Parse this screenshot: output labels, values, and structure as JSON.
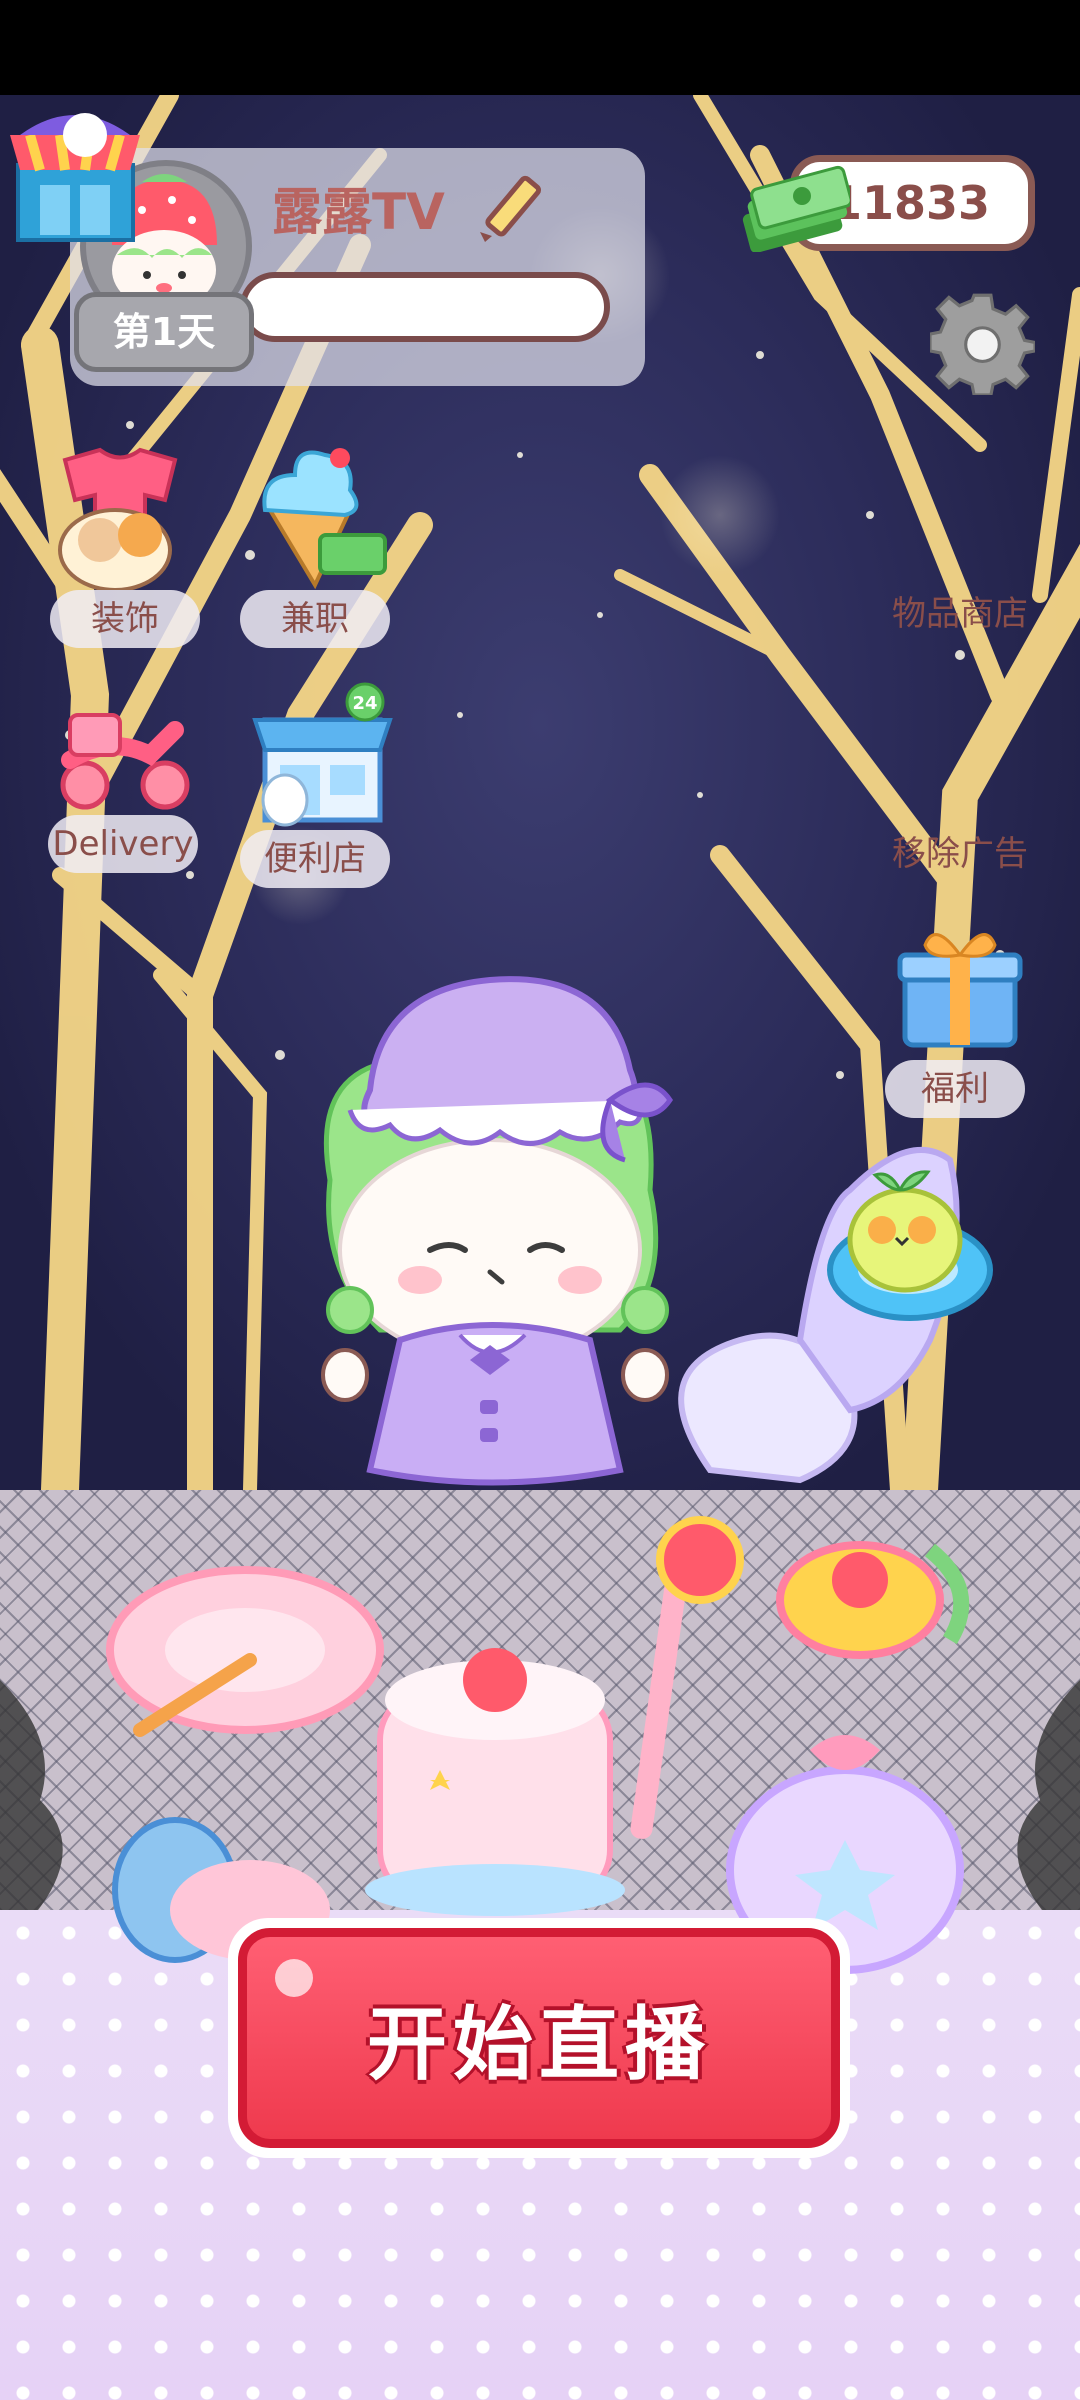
{
  "header": {
    "channel_name": "露露TV",
    "day_label": "第1天",
    "money": "11833",
    "progress": 0
  },
  "menu": {
    "decorate": "装饰",
    "part_time": "兼职",
    "delivery": "Delivery",
    "convenience_store": "便利店",
    "item_shop": "物品商店",
    "remove_ads": "移除广告",
    "welfare": "福利"
  },
  "store_badge": "24",
  "start_button": "开始直播",
  "colors": {
    "accent_red": "#ef3a4e",
    "text_brown": "#8a4e4a",
    "night_sky": "#2c2c5a",
    "tree_gold": "#f4d27a",
    "floor_lilac": "#e9d8f6"
  },
  "icons": {
    "shop": "shop-stall-icon",
    "edit": "pencil-icon",
    "money": "cash-stack-icon",
    "settings": "gear-icon",
    "decorate": "clothes-icon",
    "part_time": "ice-cream-icon",
    "delivery": "scooter-icon",
    "convenience_store": "store-icon",
    "welfare": "gift-icon"
  }
}
